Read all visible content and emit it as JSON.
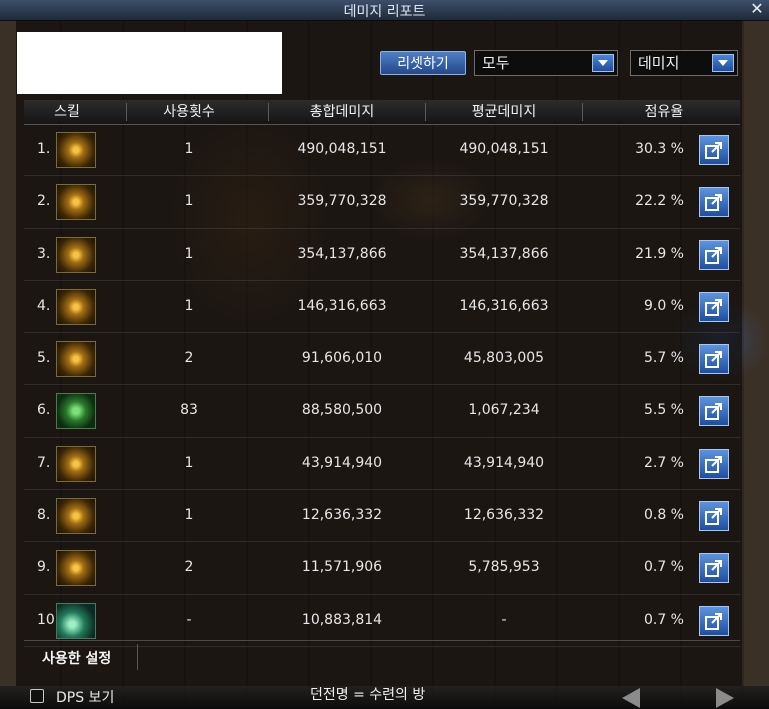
{
  "window": {
    "title": "데미지 리포트"
  },
  "controls": {
    "reset_label": "리셋하기",
    "mode_select": "모두",
    "type_select": "데미지"
  },
  "columns": [
    "스킬",
    "사용횟수",
    "총합데미지",
    "평균데미지",
    "점유율"
  ],
  "rows": [
    {
      "rank": "1.",
      "uses": "1",
      "total": "490,048,151",
      "average": "490,048,151",
      "share": "30.3 %",
      "icon": "gold-swirl-skill-icon"
    },
    {
      "rank": "2.",
      "uses": "1",
      "total": "359,770,328",
      "average": "359,770,328",
      "share": "22.2 %",
      "icon": "gold-beam-skill-icon"
    },
    {
      "rank": "3.",
      "uses": "1",
      "total": "354,137,866",
      "average": "354,137,866",
      "share": "21.9 %",
      "icon": "gold-sun-skill-icon"
    },
    {
      "rank": "4.",
      "uses": "1",
      "total": "146,316,663",
      "average": "146,316,663",
      "share": "9.0 %",
      "icon": "gold-slash-skill-icon"
    },
    {
      "rank": "5.",
      "uses": "2",
      "total": "91,606,010",
      "average": "45,803,005",
      "share": "5.7 %",
      "icon": "gold-vortex-skill-icon"
    },
    {
      "rank": "6.",
      "uses": "83",
      "total": "88,580,500",
      "average": "1,067,234",
      "share": "5.5 %",
      "icon": "green-rune-skill-icon"
    },
    {
      "rank": "7.",
      "uses": "1",
      "total": "43,914,940",
      "average": "43,914,940",
      "share": "2.7 %",
      "icon": "gold-orb-skill-icon"
    },
    {
      "rank": "8.",
      "uses": "1",
      "total": "12,636,332",
      "average": "12,636,332",
      "share": "0.8 %",
      "icon": "gold-crescent-skill-icon"
    },
    {
      "rank": "9.",
      "uses": "2",
      "total": "11,571,906",
      "average": "5,785,953",
      "share": "0.7 %",
      "icon": "gold-burst-skill-icon"
    },
    {
      "rank": "10.",
      "uses": "-",
      "total": "10,883,814",
      "average": "-",
      "share": "0.7 %",
      "icon": "teal-slash-skill-icon"
    }
  ],
  "footer": {
    "settings_label": "사용한 설정",
    "dps_label": "DPS 보기",
    "dungeon_label": "던전명 = 수련의 방"
  }
}
